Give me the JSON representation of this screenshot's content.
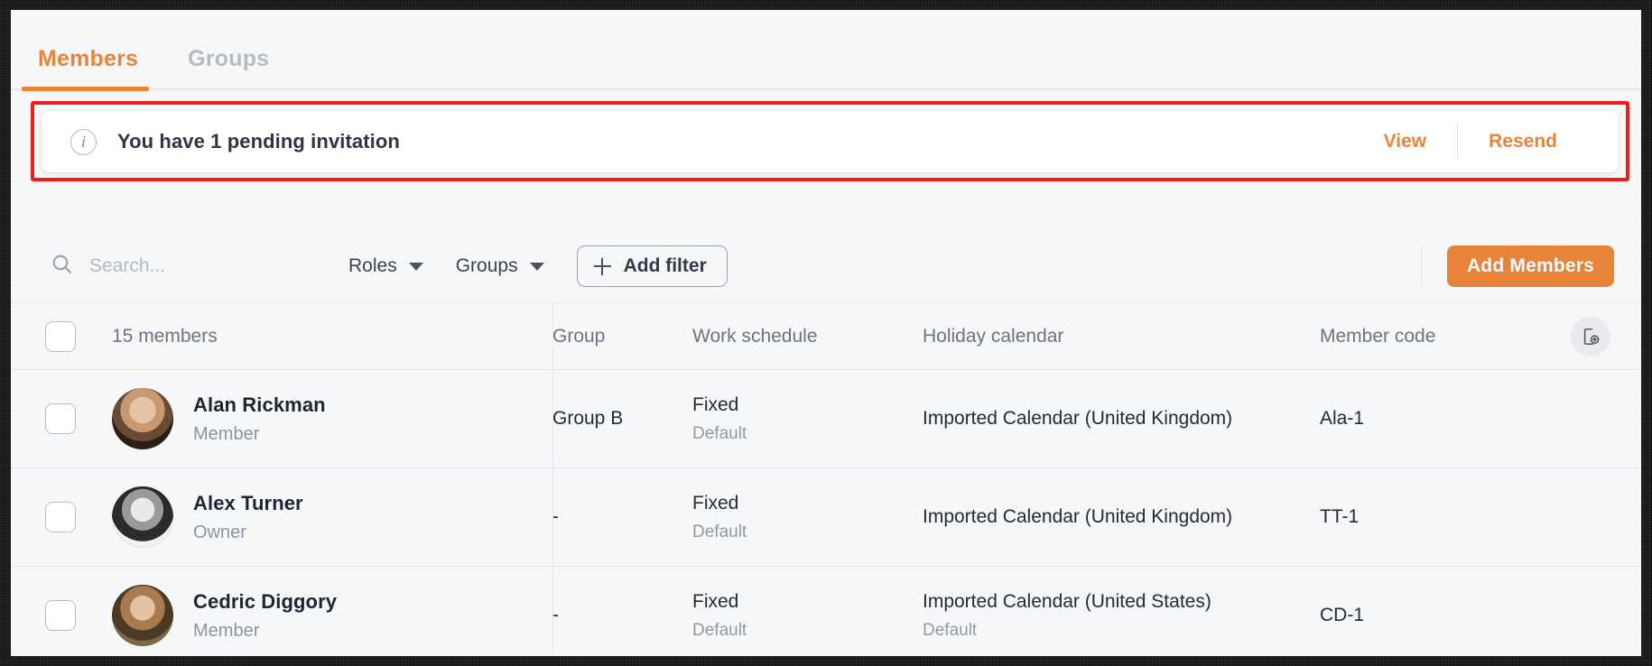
{
  "tabs": [
    {
      "label": "Members",
      "active": true
    },
    {
      "label": "Groups",
      "active": false
    }
  ],
  "banner": {
    "icon": "info-icon",
    "message": "You have 1 pending invitation",
    "view_label": "View",
    "resend_label": "Resend"
  },
  "toolbar": {
    "search_placeholder": "Search...",
    "search_value": "",
    "search_icon": "search-icon",
    "filters": [
      {
        "label": "Roles"
      },
      {
        "label": "Groups"
      }
    ],
    "add_filter_label": "Add filter",
    "add_members_label": "Add Members"
  },
  "table": {
    "count_label": "15 members",
    "columns": [
      {
        "key": "group",
        "label": "Group"
      },
      {
        "key": "schedule",
        "label": "Work schedule"
      },
      {
        "key": "holiday",
        "label": "Holiday calendar"
      },
      {
        "key": "code",
        "label": "Member code"
      }
    ],
    "add_column_icon": "add-column-icon",
    "rows": [
      {
        "name": "Alan Rickman",
        "role": "Member",
        "avatar": "av-alan",
        "group": "Group B",
        "schedule": "Fixed",
        "schedule_sub": "Default",
        "holiday": "Imported Calendar (United Kingdom)",
        "holiday_sub": "",
        "code": "Ala-1"
      },
      {
        "name": "Alex Turner",
        "role": "Owner",
        "avatar": "av-alex",
        "group": "-",
        "schedule": "Fixed",
        "schedule_sub": "Default",
        "holiday": "Imported Calendar (United Kingdom)",
        "holiday_sub": "",
        "code": "TT-1"
      },
      {
        "name": "Cedric Diggory",
        "role": "Member",
        "avatar": "av-cedric",
        "group": "-",
        "schedule": "Fixed",
        "schedule_sub": "Default",
        "holiday": "Imported Calendar (United States)",
        "holiday_sub": "Default",
        "code": "CD-1"
      }
    ]
  },
  "colors": {
    "accent": "#e8833a",
    "highlight": "#ee1c1c",
    "page_bg": "#f6f7f9",
    "text": "#1f2430",
    "muted": "#8e939e"
  }
}
